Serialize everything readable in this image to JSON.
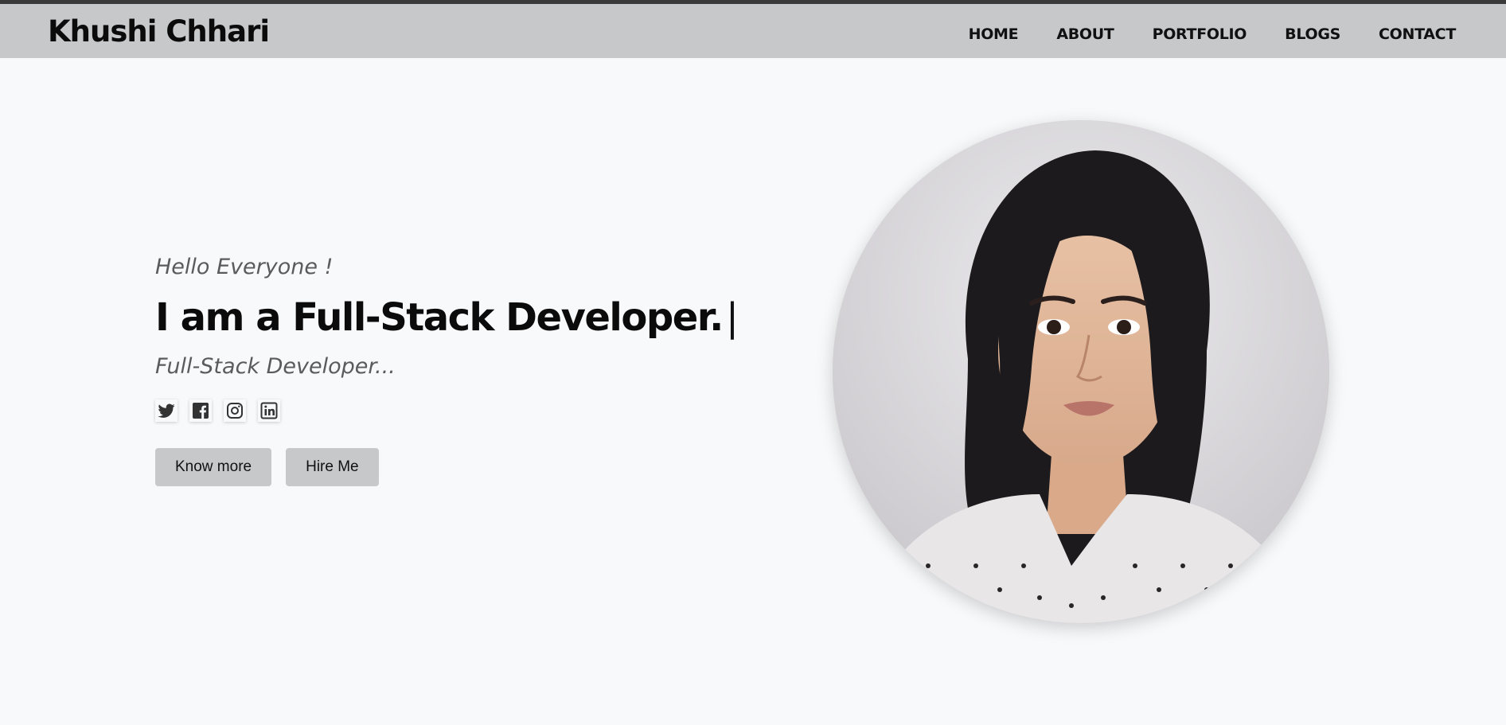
{
  "header": {
    "brand": "Khushi Chhari",
    "nav": [
      {
        "label": "HOME"
      },
      {
        "label": "ABOUT"
      },
      {
        "label": "PORTFOLIO"
      },
      {
        "label": "BLOGS"
      },
      {
        "label": "CONTACT"
      }
    ]
  },
  "hero": {
    "greeting": "Hello Everyone !",
    "headline": "I am a Full-Stack Developer.",
    "cursor": "|",
    "role": "Full-Stack Developer...",
    "socials": [
      {
        "icon": "twitter-icon"
      },
      {
        "icon": "facebook-icon"
      },
      {
        "icon": "instagram-icon"
      },
      {
        "icon": "linkedin-icon"
      }
    ],
    "buttons": {
      "know_more": "Know more",
      "hire_me": "Hire Me"
    }
  },
  "colors": {
    "navbar_bg": "#c7c8ca",
    "page_bg": "#f8f9fb",
    "button_bg": "#c7c8ca",
    "text_dark": "#0b0b0b",
    "text_muted": "#5b5b5b"
  }
}
